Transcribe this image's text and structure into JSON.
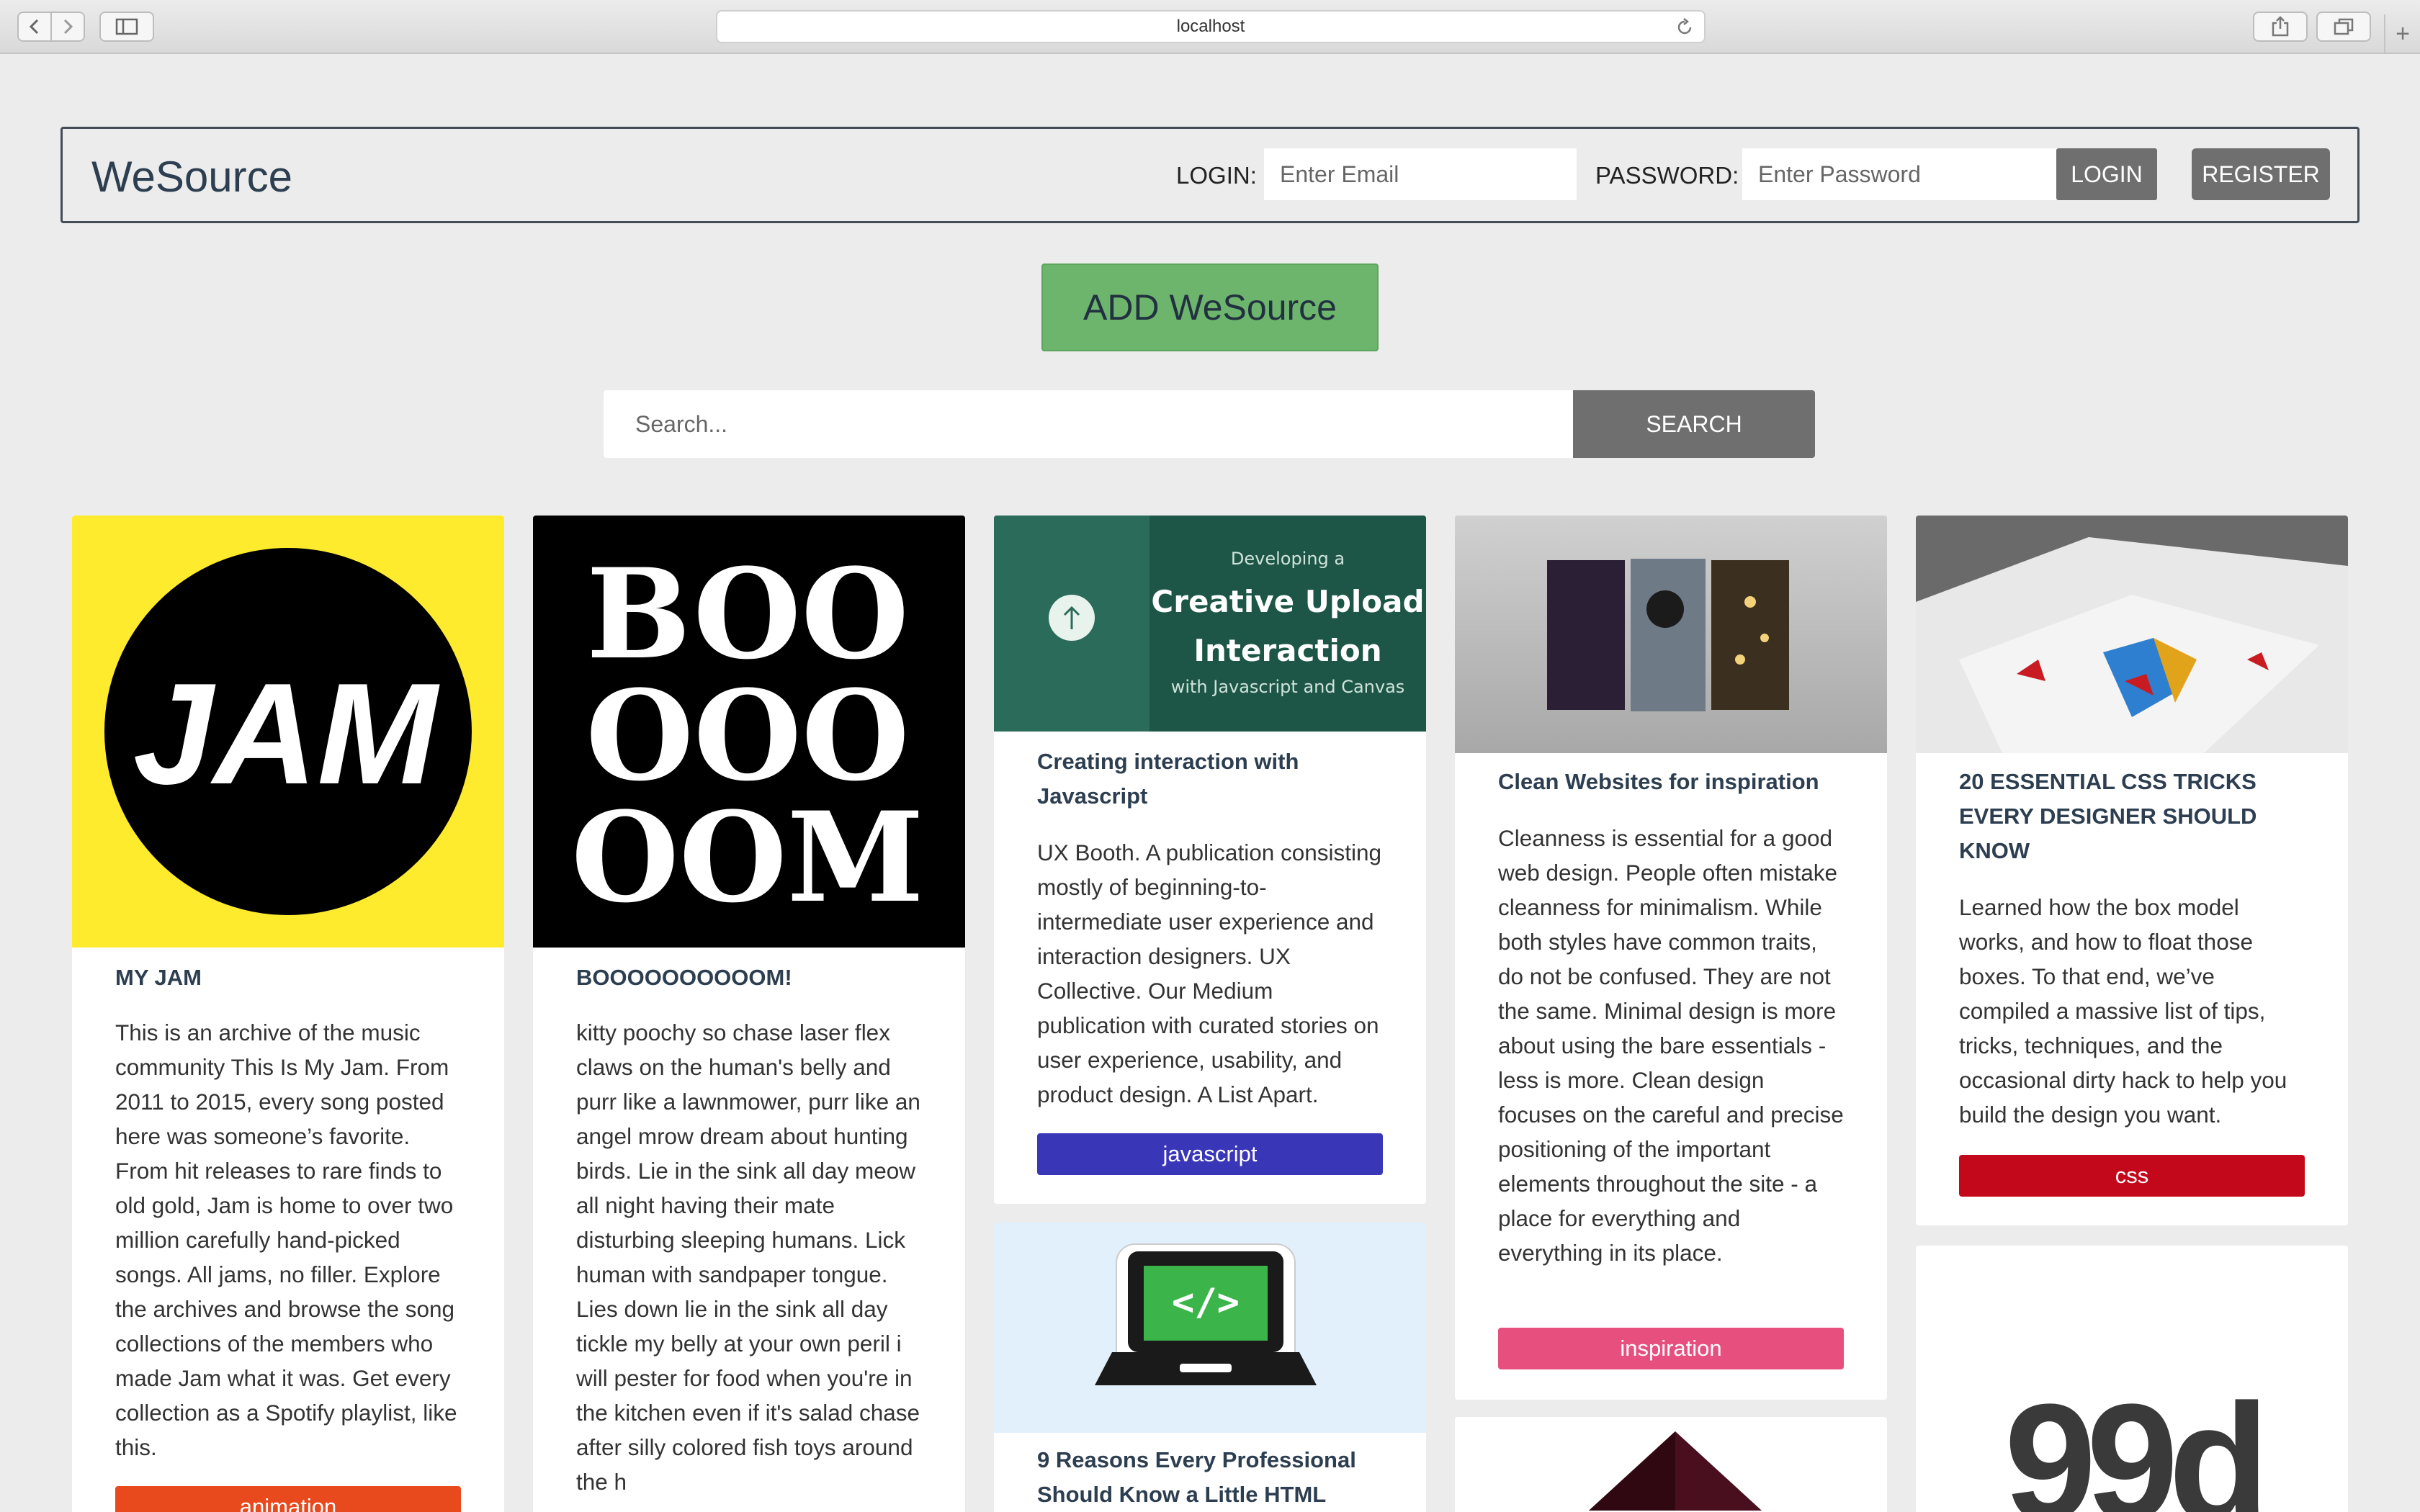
{
  "browser": {
    "url": "localhost",
    "icons": [
      "back-icon",
      "forward-icon",
      "sidebar-icon",
      "reload-icon",
      "share-icon",
      "tabs-icon",
      "plus-icon"
    ]
  },
  "header": {
    "brand": "WeSource",
    "login_label": "LOGIN:",
    "email_placeholder": "Enter Email",
    "password_label": "PASSWORD:",
    "password_placeholder": "Enter Password",
    "login_button": "LOGIN",
    "register_button": "REGISTER"
  },
  "actions": {
    "add_button": "ADD WeSource",
    "search_placeholder": "Search...",
    "search_button": "SEARCH"
  },
  "cards": [
    {
      "image_text": "JAM",
      "title": "MY JAM",
      "body": "This is an archive of the music community This Is My Jam. From 2011 to 2015, every song posted here was someone’s favorite. From hit releases to rare finds to old gold, Jam is home to over two million carefully hand-picked songs. All jams, no filler. Explore the archives and browse the song collections of the members who made Jam what it was. Get every collection as a Spotify playlist, like this.",
      "tag": "animation",
      "tag_color": "#e8491d"
    },
    {
      "image_lines": [
        "BOO",
        "OOO",
        "OOM"
      ],
      "title": "BOOOOOOOOOOM!",
      "body": "kitty poochy so chase laser flex claws on the human's belly and purr like a lawnmower, purr like an angel mrow dream about hunting birds. Lie in the sink all day meow all night having their mate disturbing sleeping humans. Lick human with sandpaper tongue. Lies down lie in the sink all day tickle my belly at your own peril i will pester for food when you're in the kitchen even if it's salad chase after silly colored fish toys around the h"
    },
    {
      "image_small": "Developing a",
      "image_big1": "Creative Upload",
      "image_big2": "Interaction",
      "image_sub": "with Javascript and Canvas",
      "title_lines": [
        "Creating interaction with",
        "Javascript"
      ],
      "body": "UX Booth. A publication consisting mostly of beginning-to-intermediate user experience and interaction designers. UX Collective. Our Medium publication with curated stories on user experience, usability, and product design. A List Apart.",
      "tag": "javascript",
      "tag_color": "#3a36b8"
    },
    {
      "image_code": "</>",
      "title_lines": [
        "9 Reasons Every Professional",
        "Should Know a Little HTML"
      ]
    },
    {
      "title": "Clean Websites for inspiration",
      "body": "Cleanness is essential for a good web design. People often mistake cleanness for minimalism. While both styles have common traits, do not be confused. They are not the same. Minimal design is more about using the bare essentials - less is more. Clean design focuses on the careful and precise positioning of the important elements throughout the site - a place for everything and everything in its place.",
      "tag": "inspiration",
      "tag_color": "#e7507e"
    },
    {
      "title_lines": [
        "20 ESSENTIAL CSS TRICKS",
        "EVERY DESIGNER SHOULD",
        "KNOW"
      ],
      "body": "Learned how the box model works, and how to float those boxes. To that end, we’ve compiled a massive list of tips, tricks, techniques, and the occasional dirty hack to help you build the design you want.",
      "tag": "css",
      "tag_color": "#c4081b"
    },
    {
      "logo_text": "99d"
    }
  ]
}
